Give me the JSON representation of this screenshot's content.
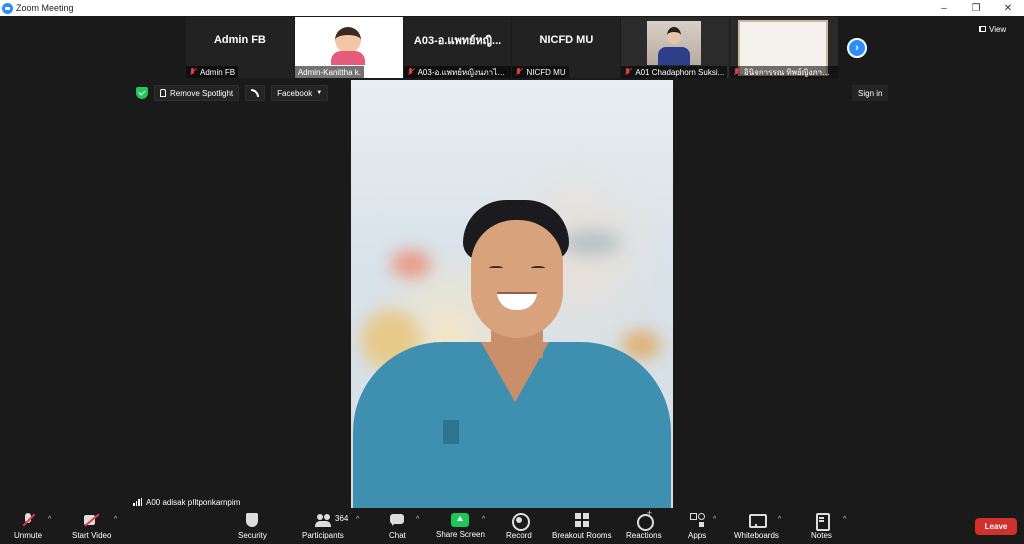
{
  "window": {
    "title": "Zoom Meeting",
    "minimize": "–",
    "restore": "❐",
    "close": "✕"
  },
  "gallery": [
    {
      "name": "Admin FB",
      "label": "Admin FB",
      "kind": "text"
    },
    {
      "name": "",
      "label": "Admin-Kanittha k.",
      "kind": "slide"
    },
    {
      "name": "A03-อ.แพทย์หญิ...",
      "label": "A03-อ.แพทย์หญิงนภาไพ...",
      "kind": "text"
    },
    {
      "name": "NICFD MU",
      "label": "NICFD MU",
      "kind": "text"
    },
    {
      "name": "",
      "label": "A01 Chadaphorn Suksi...",
      "kind": "photo"
    },
    {
      "name": "",
      "label": "อินิจการรณ ทิพย์ญิงภาพร...",
      "kind": "whiteboard"
    }
  ],
  "view_label": "View",
  "spotlight_bar": {
    "remove_spotlight": "Remove Spotlight",
    "stream_target": "Facebook",
    "sign_in": "Sign in"
  },
  "active_speaker": {
    "name": "A00 adisak pIltponkarnpim"
  },
  "toolbar": {
    "unmute": "Unmute",
    "start_video": "Start Video",
    "security": "Security",
    "participants": "Participants",
    "participant_count": "364",
    "chat": "Chat",
    "share_screen": "Share Screen",
    "record": "Record",
    "breakout_rooms": "Breakout Rooms",
    "reactions": "Reactions",
    "apps": "Apps",
    "whiteboards": "Whiteboards",
    "notes": "Notes",
    "leave": "Leave",
    "caret": "^"
  },
  "colors": {
    "accent_blue": "#2d8cff",
    "share_green": "#21c65a",
    "leave_red": "#d0312d",
    "muted_red": "#e03e3e",
    "background": "#1a1a1a"
  }
}
